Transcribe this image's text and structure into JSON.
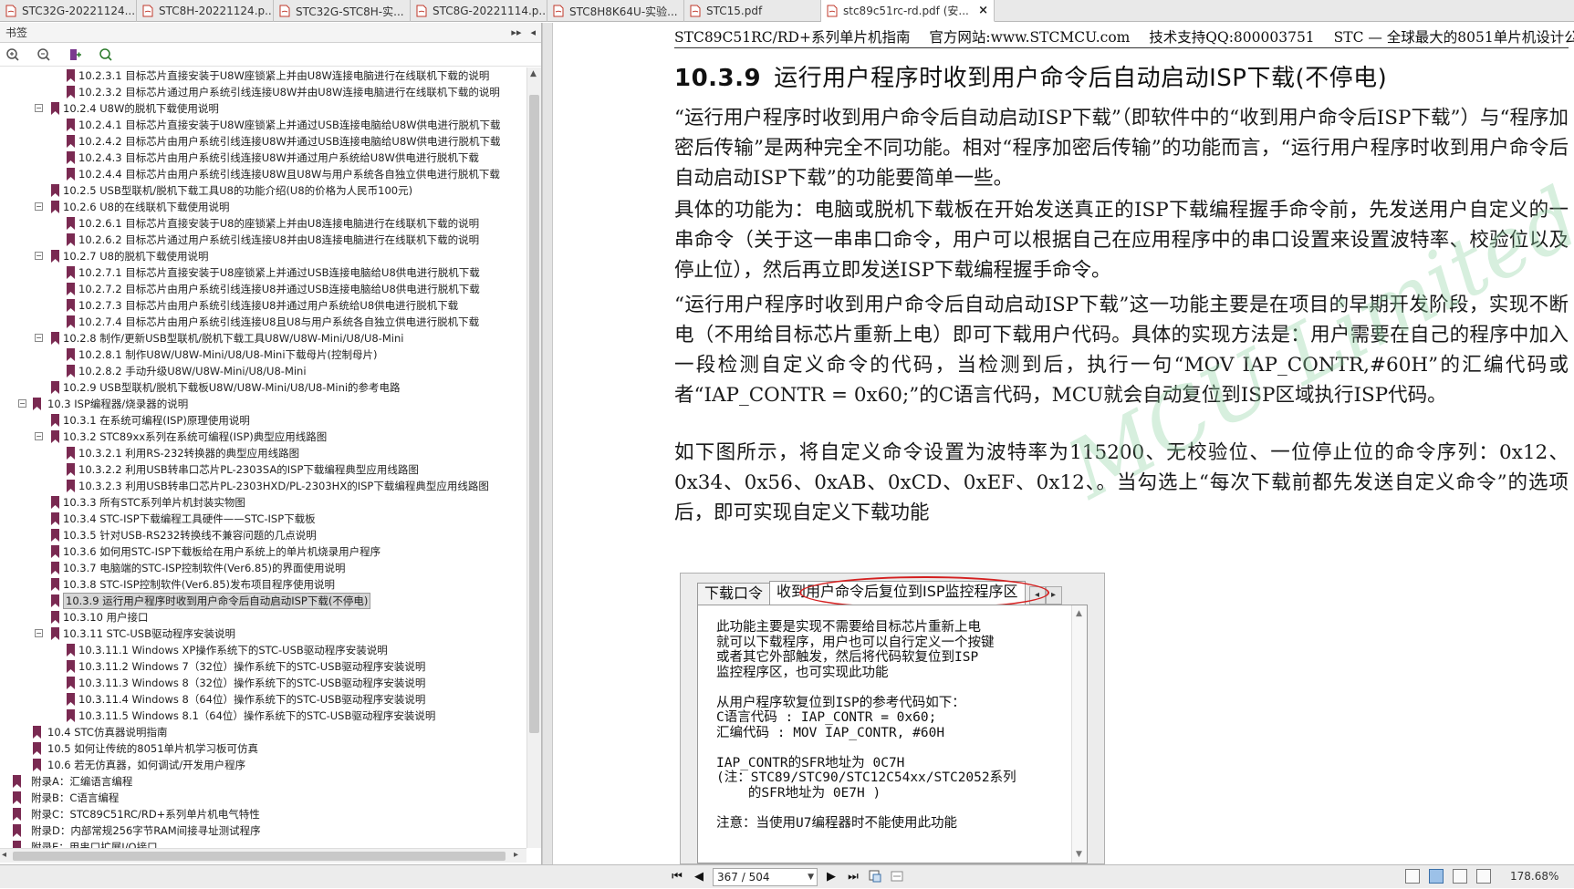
{
  "tabs": [
    {
      "label": "STC32G-20221124...",
      "active": false
    },
    {
      "label": "STC8H-20221124.p...",
      "active": false
    },
    {
      "label": "STC32G-STC8H-实...",
      "active": false
    },
    {
      "label": "STC8G-20221114.p...",
      "active": false
    },
    {
      "label": "STC8H8K64U-实验...",
      "active": false
    },
    {
      "label": "STC15.pdf",
      "active": false
    },
    {
      "label": "stc89c51rc-rd.pdf (安...",
      "active": true,
      "close": "×"
    }
  ],
  "bookmarks": {
    "title": "书签",
    "header_buttons": [
      "▸▸",
      "◂"
    ],
    "items": [
      {
        "label": "10.2.3.1 目标芯片直接安装于U8W座锁紧上并由U8W连接电脑进行在线联机下载的说明",
        "level": 3
      },
      {
        "label": "10.2.3.2 目标芯片通过用户系统引线连接U8W并由U8W连接电脑进行在线联机下载的说明",
        "level": 3
      },
      {
        "label": "10.2.4 U8W的脱机下载使用说明",
        "level": 2,
        "expander": "−"
      },
      {
        "label": "10.2.4.1 目标芯片直接安装于U8W座锁紧上并通过USB连接电脑给U8W供电进行脱机下载",
        "level": 3
      },
      {
        "label": "10.2.4.2 目标芯片由用户系统引线连接U8W并通过USB连接电脑给U8W供电进行脱机下载",
        "level": 3
      },
      {
        "label": "10.2.4.3 目标芯片由用户系统引线连接U8W并通过用户系统给U8W供电进行脱机下载",
        "level": 3
      },
      {
        "label": "10.2.4.4 目标芯片由用户系统引线连接U8W且U8W与用户系统各自独立供电进行脱机下载",
        "level": 3
      },
      {
        "label": "10.2.5 USB型联机/脱机下载工具U8的功能介绍(U8的价格为人民币100元)",
        "level": 2
      },
      {
        "label": "10.2.6 U8的在线联机下载使用说明",
        "level": 2,
        "expander": "−"
      },
      {
        "label": "10.2.6.1 目标芯片直接安装于U8的座锁紧上并由U8连接电脑进行在线联机下载的说明",
        "level": 3
      },
      {
        "label": "10.2.6.2 目标芯片通过用户系统引线连接U8并由U8连接电脑进行在线联机下载的说明",
        "level": 3
      },
      {
        "label": "10.2.7 U8的脱机下载使用说明",
        "level": 2,
        "expander": "−"
      },
      {
        "label": "10.2.7.1 目标芯片直接安装于U8座锁紧上并通过USB连接电脑给U8供电进行脱机下载",
        "level": 3
      },
      {
        "label": "10.2.7.2 目标芯片由用户系统引线连接U8并通过USB连接电脑给U8供电进行脱机下载",
        "level": 3
      },
      {
        "label": "10.2.7.3 目标芯片由用户系统引线连接U8并通过用户系统给U8供电进行脱机下载",
        "level": 3
      },
      {
        "label": "10.2.7.4 目标芯片由用户系统引线连接U8且U8与用户系统各自独立供电进行脱机下载",
        "level": 3
      },
      {
        "label": "10.2.8 制作/更新USB型联机/脱机下载工具U8W/U8W-Mini/U8/U8-Mini",
        "level": 2,
        "expander": "−"
      },
      {
        "label": "10.2.8.1 制作U8W/U8W-Mini/U8/U8-Mini下载母片(控制母片)",
        "level": 3
      },
      {
        "label": "10.2.8.2 手动升级U8W/U8W-Mini/U8/U8-Mini",
        "level": 3
      },
      {
        "label": "10.2.9 USB型联机/脱机下载板U8W/U8W-Mini/U8/U8-Mini的参考电路",
        "level": 2
      },
      {
        "label": "10.3 ISP编程器/烧录器的说明",
        "level": 1,
        "expander": "−"
      },
      {
        "label": "10.3.1 在系统可编程(ISP)原理使用说明",
        "level": 2
      },
      {
        "label": "10.3.2 STC89xx系列在系统可编程(ISP)典型应用线路图",
        "level": 2,
        "expander": "−"
      },
      {
        "label": "10.3.2.1 利用RS-232转换器的典型应用线路图",
        "level": 3
      },
      {
        "label": "10.3.2.2 利用USB转串口芯片PL-2303SA的ISP下载编程典型应用线路图",
        "level": 3
      },
      {
        "label": "10.3.2.3 利用USB转串口芯片PL-2303HXD/PL-2303HX的ISP下载编程典型应用线路图",
        "level": 3
      },
      {
        "label": "10.3.3 所有STC系列单片机封装实物图",
        "level": 2
      },
      {
        "label": "10.3.4 STC-ISP下载编程工具硬件——STC-ISP下载板",
        "level": 2
      },
      {
        "label": "10.3.5 针对USB-RS232转换线不兼容问题的几点说明",
        "level": 2
      },
      {
        "label": "10.3.6 如何用STC-ISP下载板给在用户系统上的单片机烧录用户程序",
        "level": 2
      },
      {
        "label": "10.3.7 电脑端的STC-ISP控制软件(Ver6.85)的界面使用说明",
        "level": 2
      },
      {
        "label": "10.3.8 STC-ISP控制软件(Ver6.85)发布项目程序使用说明",
        "level": 2
      },
      {
        "label": "10.3.9 运行用户程序时收到用户命令后自动启动ISP下载(不停电)",
        "level": 2,
        "selected": true
      },
      {
        "label": "10.3.10 用户接口",
        "level": 2
      },
      {
        "label": "10.3.11 STC-USB驱动程序安装说明",
        "level": 2,
        "expander": "−"
      },
      {
        "label": "10.3.11.1 Windows XP操作系统下的STC-USB驱动程序安装说明",
        "level": 3
      },
      {
        "label": "10.3.11.2 Windows 7（32位）操作系统下的STC-USB驱动程序安装说明",
        "level": 3
      },
      {
        "label": "10.3.11.3 Windows 8（32位）操作系统下的STC-USB驱动程序安装说明",
        "level": 3
      },
      {
        "label": "10.3.11.4 Windows 8（64位）操作系统下的STC-USB驱动程序安装说明",
        "level": 3
      },
      {
        "label": "10.3.11.5 Windows 8.1（64位）操作系统下的STC-USB驱动程序安装说明",
        "level": 3
      },
      {
        "label": "10.4 STC仿真器说明指南",
        "level": 1
      },
      {
        "label": "10.5 如何让传统的8051单片机学习板可仿真",
        "level": 1
      },
      {
        "label": "10.6 若无仿真器，如何调试/开发用户程序",
        "level": 1
      },
      {
        "label": "附录A：汇编语言编程",
        "level": 0
      },
      {
        "label": "附录B：C语言编程",
        "level": 0
      },
      {
        "label": "附录C：STC89C51RC/RD+系列单片机电气特性",
        "level": 0
      },
      {
        "label": "附录D：内部常规256字节RAM间接寻址测试程序",
        "level": 0
      },
      {
        "label": "附录E：用串口扩展I/O接口",
        "level": 0
      }
    ]
  },
  "document": {
    "running_header": [
      "STC89C51RC/RD+系列单片机指南",
      "官方网站:www.STCMCU.com",
      "技术支持QQ:800003751",
      "STC — 全球最大的8051单片机设计公司"
    ],
    "section_number": "10.3.9",
    "section_title": "运行用户程序时收到用户命令后自动启动ISP下载(不停电)",
    "paragraphs": [
      "“运行用户程序时收到用户命令后自动启动ISP下载”（即软件中的“收到用户命令后ISP下载”）与“程序加密后传输”是两种完全不同功能。相对“程序加密后传输”的功能而言，“运行用户程序时收到用户命令后自动启动ISP下载”的功能要简单一些。",
      "具体的功能为：电脑或脱机下载板在开始发送真正的ISP下载编程握手命令前，先发送用户自定义的一串命令（关于这一串串口命令，用户可以根据自己在应用程序中的串口设置来设置波特率、校验位以及停止位），然后再立即发送ISP下载编程握手命令。",
      "“运行用户程序时收到用户命令后自动启动ISP下载”这一功能主要是在项目的早期开发阶段，实现不断电（不用给目标芯片重新上电）即可下载用户代码。具体的实现方法是：用户需要在自己的程序中加入一段检测自定义命令的代码，当检测到后，执行一句“MOV IAP_CONTR,#60H”的汇编代码或者“IAP_CONTR = 0x60;”的C语言代码，MCU就会自动复位到ISP区域执行ISP代码。",
      "如下图所示，将自定义命令设置为波特率为115200、无校验位、一位停止位的命令序列：0x12、0x34、0x56、0xAB、0xCD、0xEF、0x12、。当勾选上“每次下载前都先发送自定义命令”的选项后，即可实现自定义下载功能"
    ],
    "watermark": "MCU Limited.",
    "dialog": {
      "tab_inactive": "下载口令",
      "tab_active": "收到用户命令后复位到ISP监控程序区",
      "arrows": [
        "◂",
        "▸"
      ],
      "text": "此功能主要是实现不需要给目标芯片重新上电\n就可以下载程序，用户也可以自行定义一个按键\n或者其它外部触发，然后将代码软复位到ISP\n监控程序区，也可实现此功能\n\n从用户程序软复位到ISP的参考代码如下：\nC语言代码 : IAP_CONTR = 0x60;\n汇编代码 : MOV IAP_CONTR, #60H\n\nIAP_CONTR的SFR地址为 0C7H\n(注：STC89/STC90/STC12C54xx/STC2052系列\n    的SFR地址为 0E7H )\n\n注意：当使用U7编程器时不能使用此功能"
    }
  },
  "statusbar": {
    "nav_buttons": [
      "⏮",
      "◀",
      "▶",
      "⏭"
    ],
    "page_display": "367 / 504",
    "zoom": "178.68%"
  },
  "colors": {
    "ellipse": "#d42020",
    "watermark": "#8cd2a0",
    "bookmark_flag": "#7a2a52"
  }
}
